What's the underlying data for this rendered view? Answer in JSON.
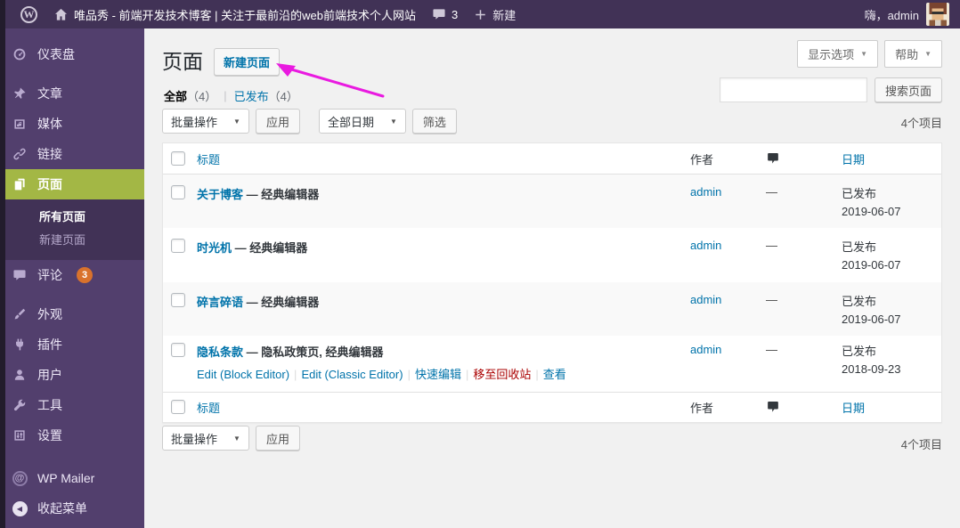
{
  "admin_bar": {
    "site_title": "唯品秀 - 前端开发技术博客 | 关注于最前沿的web前端技术个人网站",
    "comment_count": "3",
    "new_label": "新建",
    "greeting": "嗨，admin"
  },
  "sidebar": {
    "items": [
      {
        "label": "仪表盘"
      },
      {
        "label": "文章"
      },
      {
        "label": "媒体"
      },
      {
        "label": "链接"
      },
      {
        "label": "页面"
      },
      {
        "label": "评论",
        "badge": "3"
      },
      {
        "label": "外观"
      },
      {
        "label": "插件"
      },
      {
        "label": "用户"
      },
      {
        "label": "工具"
      },
      {
        "label": "设置"
      },
      {
        "label": "WP Mailer"
      },
      {
        "label": "收起菜单"
      }
    ],
    "submenu": [
      {
        "label": "所有页面"
      },
      {
        "label": "新建页面"
      }
    ]
  },
  "page": {
    "title": "页面",
    "add_new_label": "新建页面"
  },
  "screen_meta": {
    "screen_options": "显示选项",
    "help": "帮助"
  },
  "views": {
    "all": "全部",
    "all_count": "（4）",
    "separator": "|",
    "published": "已发布",
    "published_count": "（4）"
  },
  "search": {
    "value": "",
    "button_label": "搜索页面"
  },
  "toolbar": {
    "bulk_action": "批量操作",
    "apply": "应用",
    "all_dates": "全部日期",
    "filter": "筛选",
    "item_count": "4个项目"
  },
  "table": {
    "columns": {
      "title": "标题",
      "author": "作者",
      "date": "日期"
    },
    "rows": [
      {
        "title": "关于博客",
        "state": "— 经典编辑器",
        "author": "admin",
        "comments": "—",
        "status": "已发布",
        "date": "2019-06-07"
      },
      {
        "title": "时光机",
        "state": "— 经典编辑器",
        "author": "admin",
        "comments": "—",
        "status": "已发布",
        "date": "2019-06-07"
      },
      {
        "title": "碎言碎语",
        "state": "— 经典编辑器",
        "author": "admin",
        "comments": "—",
        "status": "已发布",
        "date": "2019-06-07"
      },
      {
        "title": "隐私条款",
        "state": "— 隐私政策页, 经典编辑器",
        "author": "admin",
        "comments": "—",
        "status": "已发布",
        "date": "2018-09-23",
        "actions": {
          "edit_block": "Edit (Block Editor)",
          "edit_classic": "Edit (Classic Editor)",
          "quick_edit": "快速编辑",
          "trash": "移至回收站",
          "view": "查看"
        }
      }
    ]
  },
  "colors": {
    "accent_green": "#a3b745",
    "sidebar_purple": "#523f6d",
    "adminbar_purple": "#413256",
    "badge_orange": "#d9722c",
    "link_blue": "#0073aa",
    "trash_red": "#aa0000",
    "annotation_magenta": "#e91ae0"
  }
}
